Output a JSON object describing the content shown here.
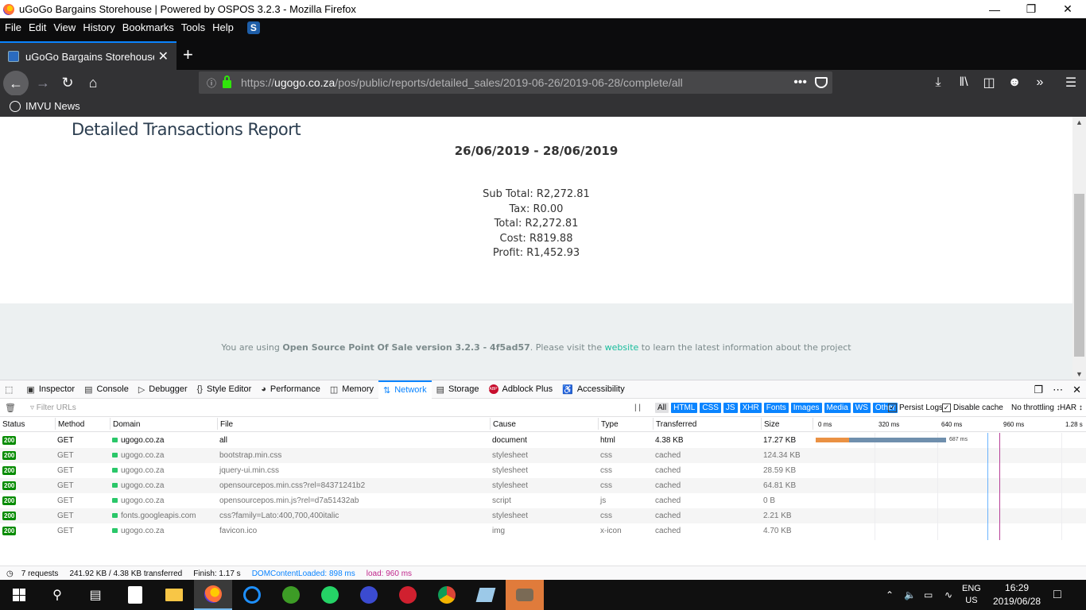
{
  "window": {
    "title": "uGoGo Bargains Storehouse | Powered by OSPOS 3.2.3 - Mozilla Firefox"
  },
  "menu": [
    "File",
    "Edit",
    "View",
    "History",
    "Bookmarks",
    "Tools",
    "Help"
  ],
  "tab": {
    "title": "uGoGo Bargains Storehouse | P"
  },
  "url": {
    "prefix": "https://",
    "host": "ugogo.co.za",
    "path": "/pos/public/reports/detailed_sales/2019-06-26/2019-06-28/complete/all"
  },
  "bookmarks": [
    "IMVU News"
  ],
  "report": {
    "title": "Detailed Transactions Report",
    "range": "26/06/2019 - 28/06/2019",
    "summary": [
      "Sub Total: R2,272.81",
      "Tax: R0.00",
      "Total: R2,272.81",
      "Cost: R819.88",
      "Profit: R1,452.93"
    ]
  },
  "footer": {
    "before": "You are using ",
    "version": "Open Source Point Of Sale version 3.2.3 - 4f5ad57",
    "middle": ". Please visit the ",
    "link": "website",
    "after": " to learn the latest information about the project"
  },
  "devtools": {
    "tabs": [
      "Inspector",
      "Console",
      "Debugger",
      "Style Editor",
      "Performance",
      "Memory",
      "Network",
      "Storage",
      "Adblock Plus",
      "Accessibility"
    ],
    "filter_placeholder": "Filter URLs",
    "types": [
      "All",
      "HTML",
      "CSS",
      "JS",
      "XHR",
      "Fonts",
      "Images",
      "Media",
      "WS",
      "Other"
    ],
    "persist_logs": "Persist Logs",
    "disable_cache": "Disable cache",
    "throttling": "No throttling ↕",
    "har": "HAR ↕",
    "columns": [
      "Status",
      "Method",
      "Domain",
      "File",
      "Cause",
      "Type",
      "Transferred",
      "Size"
    ],
    "timeline_labels": [
      "0 ms",
      "320 ms",
      "640 ms",
      "960 ms",
      "1.28 s"
    ],
    "first_request_time": "687 ms",
    "requests": [
      {
        "status": "200",
        "method": "GET",
        "domain": "ugogo.co.za",
        "file": "all",
        "cause": "document",
        "type": "html",
        "transferred": "4.38 KB",
        "size": "17.27 KB"
      },
      {
        "status": "200",
        "method": "GET",
        "domain": "ugogo.co.za",
        "file": "bootstrap.min.css",
        "cause": "stylesheet",
        "type": "css",
        "transferred": "cached",
        "size": "124.34 KB"
      },
      {
        "status": "200",
        "method": "GET",
        "domain": "ugogo.co.za",
        "file": "jquery-ui.min.css",
        "cause": "stylesheet",
        "type": "css",
        "transferred": "cached",
        "size": "28.59 KB"
      },
      {
        "status": "200",
        "method": "GET",
        "domain": "ugogo.co.za",
        "file": "opensourcepos.min.css?rel=84371241b2",
        "cause": "stylesheet",
        "type": "css",
        "transferred": "cached",
        "size": "64.81 KB"
      },
      {
        "status": "200",
        "method": "GET",
        "domain": "ugogo.co.za",
        "file": "opensourcepos.min.js?rel=d7a51432ab",
        "cause": "script",
        "type": "js",
        "transferred": "cached",
        "size": "0 B"
      },
      {
        "status": "200",
        "method": "GET",
        "domain": "fonts.googleapis.com",
        "file": "css?family=Lato:400,700,400italic",
        "cause": "stylesheet",
        "type": "css",
        "transferred": "cached",
        "size": "2.21 KB"
      },
      {
        "status": "200",
        "method": "GET",
        "domain": "ugogo.co.za",
        "file": "favicon.ico",
        "cause": "img",
        "type": "x-icon",
        "transferred": "cached",
        "size": "4.70 KB"
      }
    ],
    "status": {
      "requests": "7 requests",
      "transferred": "241.92 KB / 4.38 KB transferred",
      "finish": "Finish: 1.17 s",
      "dom": "DOMContentLoaded: 898 ms",
      "load": "load: 960 ms"
    }
  },
  "tray": {
    "lang": "ENG",
    "region": "US",
    "time": "16:29",
    "date": "2019/06/28"
  }
}
